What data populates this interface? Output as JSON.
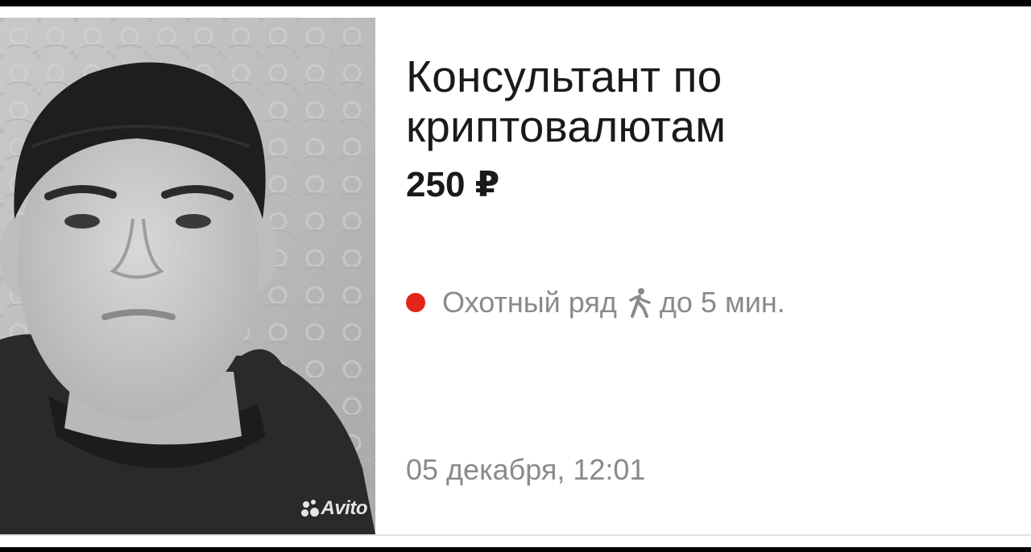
{
  "listing": {
    "title": "Консультант по криптовалютам",
    "price": "250 ₽",
    "metro": {
      "station": "Охотный ряд",
      "line_color": "#e3251b",
      "walk_icon": "walking-person-icon",
      "walk_time": "до 5 мин."
    },
    "date": "05 декабря, 12:01",
    "photo": {
      "watermark_text": "Avito",
      "watermark_icon": "avito-logo-icon"
    }
  }
}
